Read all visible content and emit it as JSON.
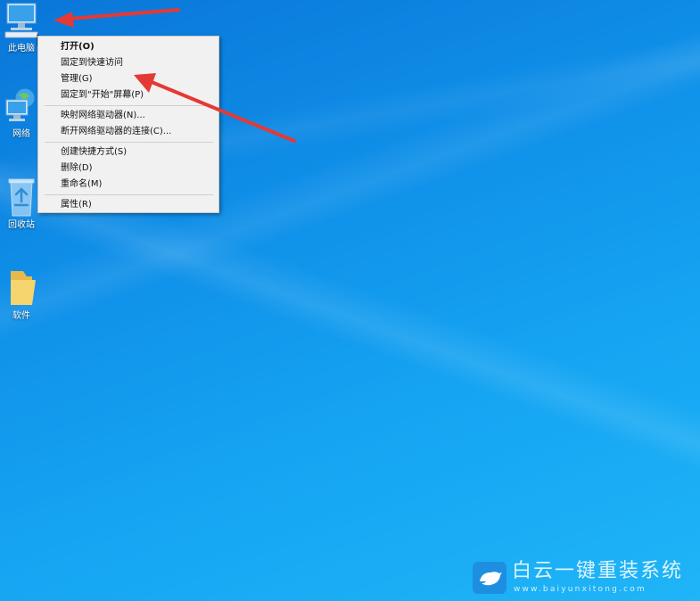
{
  "desktop": {
    "icons": [
      {
        "label": "此电脑",
        "icon": "computer-icon"
      },
      {
        "label": "网络",
        "icon": "network-icon"
      },
      {
        "label": "回收站",
        "icon": "recycle-bin-icon"
      },
      {
        "label": "软件",
        "icon": "folder-icon"
      }
    ]
  },
  "context_menu": {
    "items": [
      {
        "label": "打开(O)"
      },
      {
        "label": "固定到快速访问"
      },
      {
        "label": "管理(G)"
      },
      {
        "label": "固定到\"开始\"屏幕(P)"
      },
      {
        "label": "映射网络驱动器(N)..."
      },
      {
        "label": "断开网络驱动器的连接(C)..."
      },
      {
        "label": "创建快捷方式(S)"
      },
      {
        "label": "删除(D)"
      },
      {
        "label": "重命名(M)"
      },
      {
        "label": "属性(R)"
      }
    ]
  },
  "watermark": {
    "title": "白云一键重装系统",
    "url": "www.baiyunxitong.com",
    "icon": "bird-icon"
  },
  "colors": {
    "annotation_arrow": "#e53935",
    "menu_background": "#f1f1f1"
  }
}
